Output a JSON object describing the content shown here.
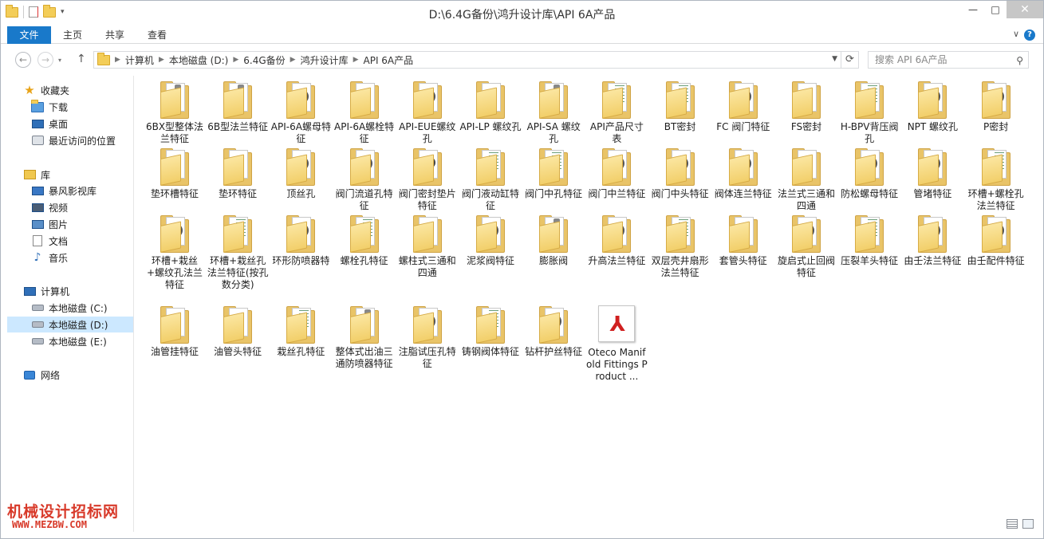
{
  "window": {
    "title": "D:\\6.4G备份\\鸿升设计库\\API 6A产品",
    "controls": {
      "minimize": "—",
      "maximize": "□",
      "close": "✕"
    }
  },
  "ribbon": {
    "tabs": [
      "文件",
      "主页",
      "共享",
      "查看"
    ],
    "help": "?",
    "collapse": "∨"
  },
  "nav": {
    "back": "←",
    "forward": "→",
    "up": "↑",
    "breadcrumbs": [
      "计算机",
      "本地磁盘 (D:)",
      "6.4G备份",
      "鸿升设计库",
      "API 6A产品"
    ],
    "refresh": "⟳",
    "search_placeholder": "搜索 API 6A产品"
  },
  "sidebar": {
    "favorites": {
      "label": "收藏夹",
      "items": [
        "下载",
        "桌面",
        "最近访问的位置"
      ]
    },
    "libraries": {
      "label": "库",
      "items": [
        "暴风影视库",
        "视频",
        "图片",
        "文档",
        "音乐"
      ]
    },
    "computer": {
      "label": "计算机",
      "items": [
        "本地磁盘 (C:)",
        "本地磁盘 (D:)",
        "本地磁盘 (E:)"
      ],
      "selected": "本地磁盘 (D:)"
    },
    "network": {
      "label": "网络"
    }
  },
  "files": [
    {
      "name": "6BX型整体法兰特征",
      "thumb": "bar"
    },
    {
      "name": "6B型法兰特征",
      "thumb": "bar"
    },
    {
      "name": "API-6A螺母特征",
      "thumb": "default"
    },
    {
      "name": "API-6A螺栓特征",
      "thumb": "red"
    },
    {
      "name": "API-EUE螺纹孔",
      "thumb": "default"
    },
    {
      "name": "API-LP 螺纹孔",
      "thumb": "blank"
    },
    {
      "name": "API-SA 螺纹孔",
      "thumb": "bar"
    },
    {
      "name": "API产品尺寸表",
      "thumb": "lines"
    },
    {
      "name": "BT密封",
      "thumb": "lines"
    },
    {
      "name": "FC 阀门特征",
      "thumb": "default"
    },
    {
      "name": "FS密封",
      "thumb": "blank"
    },
    {
      "name": "H-BPV背压阀孔",
      "thumb": "lines"
    },
    {
      "name": "NPT 螺纹孔",
      "thumb": "default"
    },
    {
      "name": "P密封",
      "thumb": "default"
    },
    {
      "name": "垫环槽特征",
      "thumb": "blank"
    },
    {
      "name": "垫环特征",
      "thumb": "blank"
    },
    {
      "name": "顶丝孔",
      "thumb": "default"
    },
    {
      "name": "阀门流道孔特征",
      "thumb": "default"
    },
    {
      "name": "阀门密封垫片特征",
      "thumb": "ring"
    },
    {
      "name": "阀门液动缸特征",
      "thumb": "lines"
    },
    {
      "name": "阀门中孔特征",
      "thumb": "lines"
    },
    {
      "name": "阀门中兰特征",
      "thumb": "default"
    },
    {
      "name": "阀门中头特征",
      "thumb": "default"
    },
    {
      "name": "阀体连兰特征",
      "thumb": "default"
    },
    {
      "name": "法兰式三通和四通",
      "thumb": "blank"
    },
    {
      "name": "防松螺母特征",
      "thumb": "default"
    },
    {
      "name": "管堵特征",
      "thumb": "default"
    },
    {
      "name": "环槽+螺栓孔法兰特征",
      "thumb": "lines"
    },
    {
      "name": "环槽+栽丝+螺纹孔法兰特征",
      "thumb": "default"
    },
    {
      "name": "环槽+栽丝孔法兰特征(按孔数分类)",
      "thumb": "lines"
    },
    {
      "name": "环形防喷器特",
      "thumb": "default"
    },
    {
      "name": "螺栓孔特征",
      "thumb": "lines"
    },
    {
      "name": "螺柱式三通和四通",
      "thumb": "blank"
    },
    {
      "name": "泥浆阀特征",
      "thumb": "default"
    },
    {
      "name": "膨胀阀",
      "thumb": "bar"
    },
    {
      "name": "升高法兰特征",
      "thumb": "default"
    },
    {
      "name": "双层壳井扇形法兰特征",
      "thumb": "lines"
    },
    {
      "name": "套管头特征",
      "thumb": "blank"
    },
    {
      "name": "旋启式止回阀特征",
      "thumb": "default"
    },
    {
      "name": "压裂羊头特征",
      "thumb": "lines"
    },
    {
      "name": "由壬法兰特征",
      "thumb": "default"
    },
    {
      "name": "由壬配件特征",
      "thumb": "default"
    },
    {
      "name": "油管挂特征",
      "thumb": "blank"
    },
    {
      "name": "油管头特征",
      "thumb": "red"
    },
    {
      "name": "栽丝孔特征",
      "thumb": "lines"
    },
    {
      "name": "整体式出油三通防喷器特征",
      "thumb": "bar"
    },
    {
      "name": "注脂试压孔特征",
      "thumb": "default"
    },
    {
      "name": "铸钢阀体特征",
      "thumb": "lines"
    },
    {
      "name": "钻杆护丝特征",
      "thumb": "default"
    }
  ],
  "pdf_file": {
    "name": "Oteco Manifold Fittings Product ..."
  },
  "watermark": {
    "line1": "机械设计招标网",
    "line2": "WWW.MEZBW.COM"
  },
  "colors": {
    "accent": "#1979ca",
    "selected_bg": "#cce8ff",
    "watermark": "#d83a2a"
  }
}
